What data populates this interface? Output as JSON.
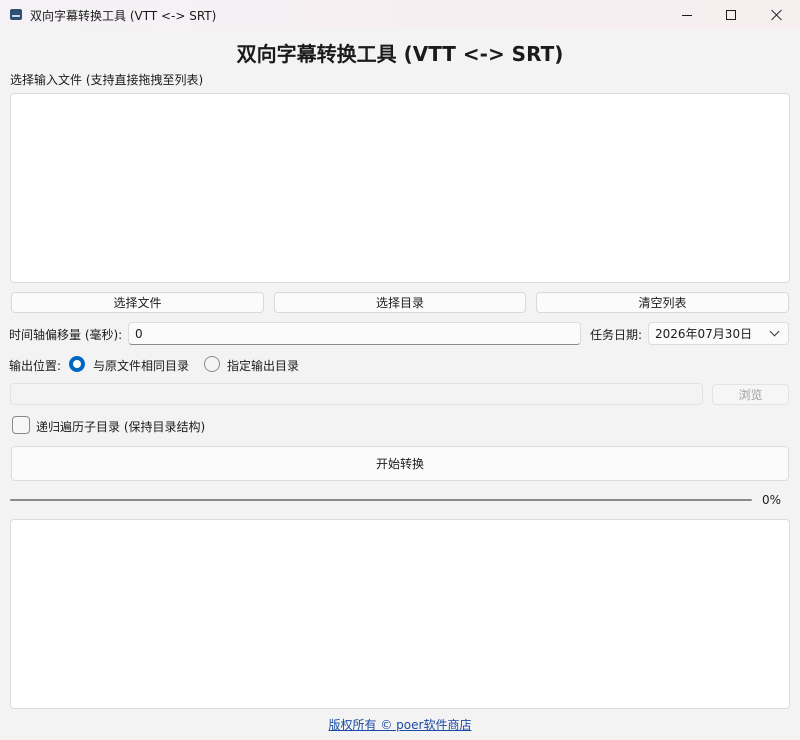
{
  "window": {
    "title": "双向字幕转换工具 (VTT <-> SRT)"
  },
  "header": {
    "title": "双向字幕转换工具 (VTT <-> SRT)"
  },
  "input": {
    "label": "选择输入文件 (支持直接拖拽至列表)",
    "buttons": {
      "choose_file": "选择文件",
      "choose_dir": "选择目录",
      "clear_list": "清空列表"
    }
  },
  "offset": {
    "label": "时间轴偏移量 (毫秒):",
    "value": "0"
  },
  "task_date": {
    "label": "任务日期:",
    "value": "2026年07月30日"
  },
  "output": {
    "label": "输出位置:",
    "option_same": "与原文件相同目录",
    "option_custom": "指定输出目录",
    "selected": "option_same",
    "path_value": "",
    "browse_label": "浏览"
  },
  "recursive": {
    "label": "递归遍历子目录 (保持目录结构)",
    "checked": false
  },
  "start_button": "开始转换",
  "progress": {
    "value": 0,
    "text": "0%"
  },
  "footer": {
    "copyright": "版权所有 © poer软件商店"
  },
  "colors": {
    "accent": "#0067c0",
    "link": "#1a4aa6"
  }
}
